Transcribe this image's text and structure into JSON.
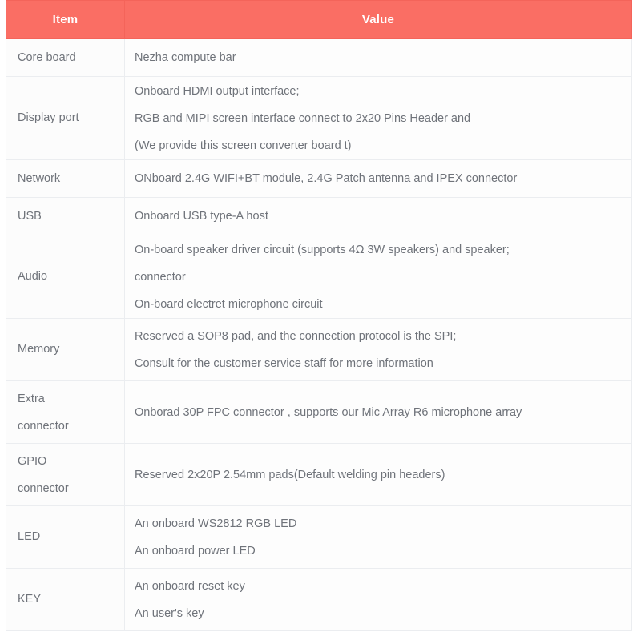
{
  "table": {
    "accent_color": "#fa6e64",
    "header_text_color": "#ffffff",
    "body_text_color": "#6f737a",
    "grid_color": "#ebedf0",
    "columns": [
      {
        "key": "item",
        "label": "Item"
      },
      {
        "key": "value",
        "label": "Value"
      }
    ],
    "rows": [
      {
        "item": [
          "Core board"
        ],
        "value": [
          "Nezha compute bar"
        ]
      },
      {
        "item": [
          "Display port"
        ],
        "value": [
          "Onboard HDMI output interface;",
          "RGB and MIPI screen interface connect to 2x20 Pins Header and",
          "(We provide this screen converter board t)"
        ]
      },
      {
        "item": [
          "Network"
        ],
        "value": [
          "ONboard 2.4G WIFI+BT module, 2.4G Patch antenna and IPEX connector"
        ]
      },
      {
        "item": [
          "USB"
        ],
        "value": [
          "Onboard USB type-A host"
        ]
      },
      {
        "item": [
          "Audio"
        ],
        "value": [
          "On-board speaker driver circuit (supports 4Ω 3W speakers) and speaker;",
          "connector",
          "On-board electret microphone circuit"
        ]
      },
      {
        "item": [
          "Memory"
        ],
        "value": [
          "Reserved a SOP8 pad, and the connection protocol is the SPI;",
          "Consult for the customer service staff for more information"
        ]
      },
      {
        "item": [
          "Extra",
          "connector"
        ],
        "value": [
          "Onborad 30P FPC connector , supports our Mic Array R6 microphone array"
        ]
      },
      {
        "item": [
          "GPIO",
          "connector"
        ],
        "value": [
          "Reserved 2x20P 2.54mm pads(Default welding pin headers)"
        ]
      },
      {
        "item": [
          "LED"
        ],
        "value": [
          "An onboard WS2812 RGB LED",
          "An onboard power LED"
        ]
      },
      {
        "item": [
          "KEY"
        ],
        "value": [
          "An onboard reset key",
          "An user's key"
        ]
      }
    ]
  }
}
